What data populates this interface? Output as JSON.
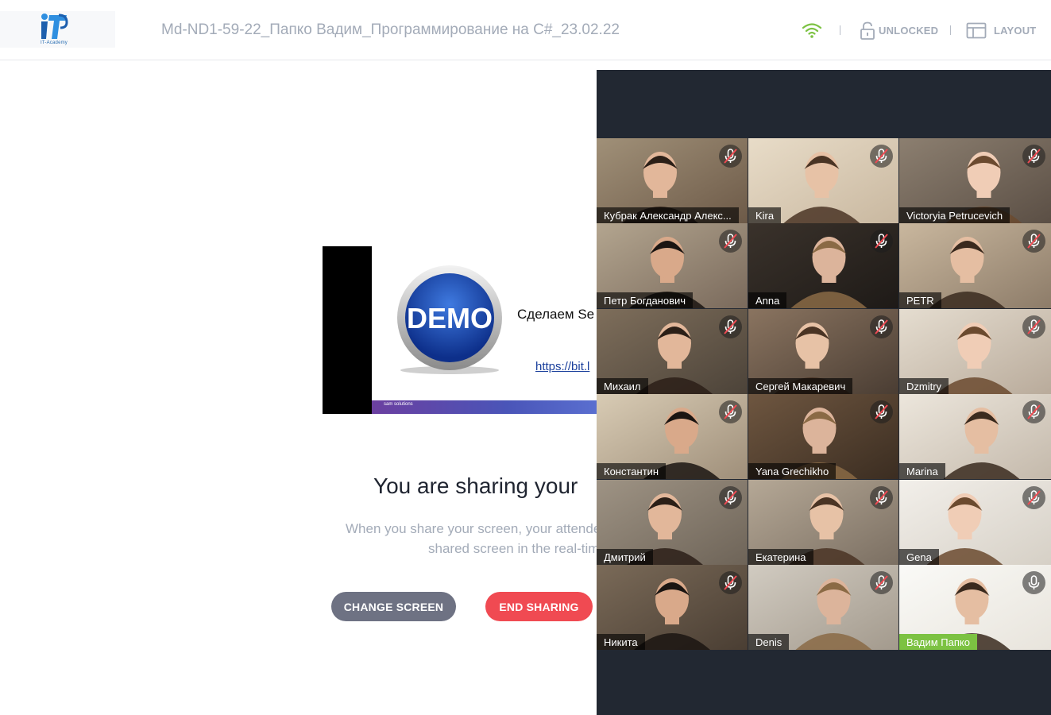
{
  "header": {
    "logo_caption": "IT-Academy",
    "meeting_title": "Md-ND1-59-22_Папко Вадим_Программирование на C#_23.02.22",
    "connection_icon": "wifi-icon",
    "lock_label": "UNLOCKED",
    "layout_label": "LAYOUT"
  },
  "colors": {
    "accent_green": "#7cc242",
    "end_red": "#f04a52",
    "change_gray": "#6e7283",
    "panel_bg": "#222832"
  },
  "preview": {
    "badge": "DEMO",
    "slide_text": "Сделаем Se",
    "slide_link": "https://bit.l",
    "brand": "sam solutions"
  },
  "sharing": {
    "heading": "You are sharing your",
    "desc_line1": "When you share your screen, your attende",
    "desc_line2": "shared screen in the real-tim",
    "change_button": "CHANGE SCREEN",
    "end_button": "END SHARING"
  },
  "participants": [
    {
      "name": "Кубрак Александр Алекс...",
      "muted": true,
      "active": false
    },
    {
      "name": "Kira",
      "muted": true,
      "active": false
    },
    {
      "name": "Victoryia Petrucevich",
      "muted": true,
      "active": false
    },
    {
      "name": "Петр Богданович",
      "muted": true,
      "active": false
    },
    {
      "name": "Anna",
      "muted": true,
      "active": false
    },
    {
      "name": "PETR",
      "muted": true,
      "active": false
    },
    {
      "name": "Михаил",
      "muted": true,
      "active": false
    },
    {
      "name": "Сергей Макаревич",
      "muted": true,
      "active": false
    },
    {
      "name": "Dzmitry",
      "muted": true,
      "active": false
    },
    {
      "name": "Константин",
      "muted": true,
      "active": false
    },
    {
      "name": "Yana Grechikho",
      "muted": true,
      "active": false
    },
    {
      "name": "Marina",
      "muted": true,
      "active": false
    },
    {
      "name": "Дмитрий",
      "muted": true,
      "active": false
    },
    {
      "name": "Екатерина",
      "muted": true,
      "active": false
    },
    {
      "name": "Gena",
      "muted": true,
      "active": false
    },
    {
      "name": "Никита",
      "muted": true,
      "active": false
    },
    {
      "name": "Denis",
      "muted": true,
      "active": false
    },
    {
      "name": "Вадим Папко",
      "muted": false,
      "active": true
    }
  ]
}
